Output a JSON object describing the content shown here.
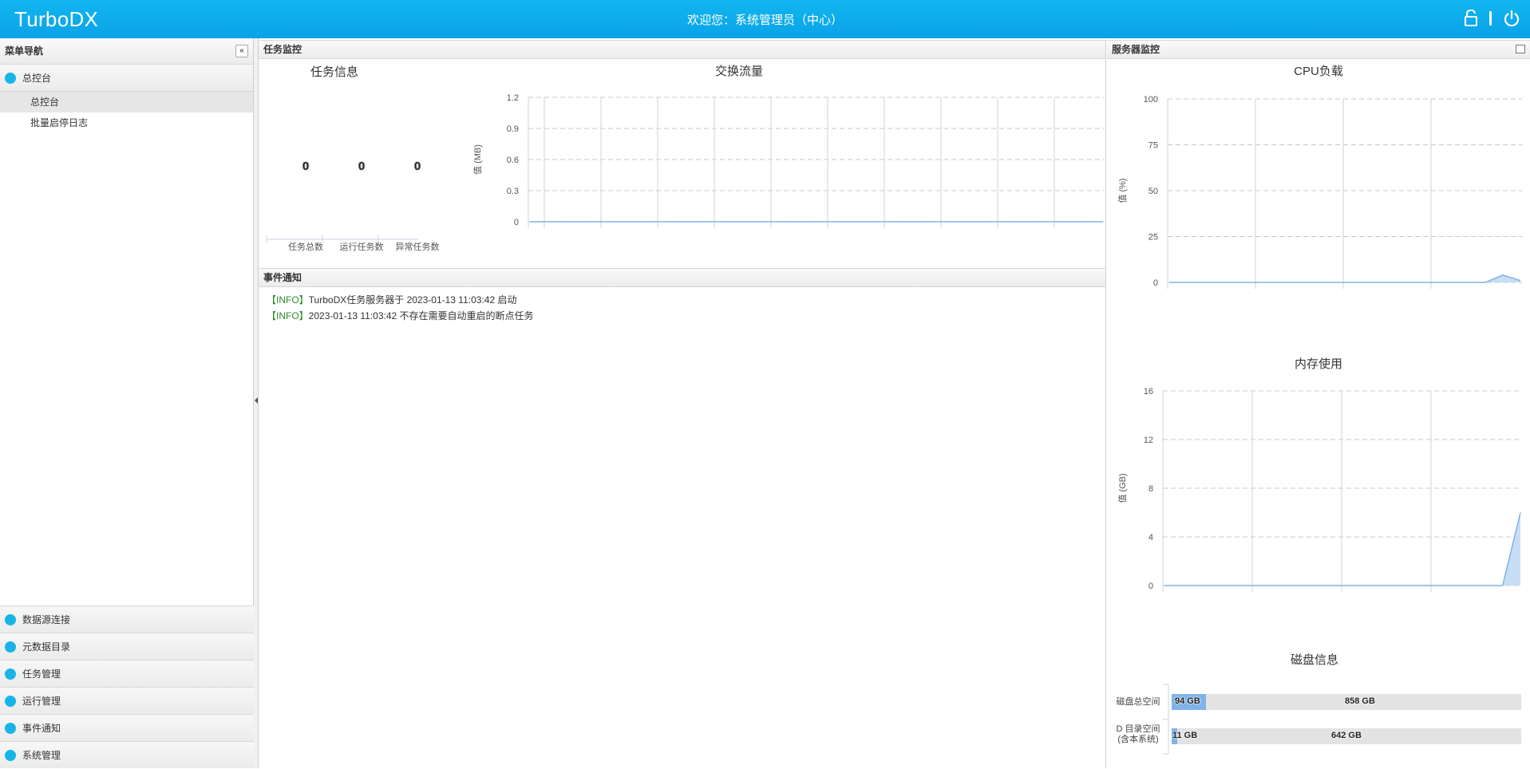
{
  "header": {
    "logo": "TurboDX",
    "welcome": "欢迎您：系统管理员（中心）"
  },
  "sidebar": {
    "title": "菜单导航",
    "group_dashboard": "总控台",
    "sub_items": [
      "总控台",
      "批量启停日志"
    ],
    "bottom_groups": [
      "数据源连接",
      "元数据目录",
      "任务管理",
      "运行管理",
      "事件通知",
      "系统管理"
    ]
  },
  "task_panel": {
    "title": "任务监控",
    "task_info": {
      "title": "任务信息",
      "stats": [
        {
          "label": "任务总数",
          "value": "0"
        },
        {
          "label": "运行任务数",
          "value": "0"
        },
        {
          "label": "异常任务数",
          "value": "0"
        }
      ]
    }
  },
  "event_panel": {
    "title": "事件通知",
    "events": [
      {
        "level": "【INFO】",
        "text": "TurboDX任务服务器于 2023-01-13 11:03:42 启动"
      },
      {
        "level": "【INFO】",
        "text": "2023-01-13 11:03:42 不存在需要自动重启的断点任务"
      }
    ]
  },
  "server_panel": {
    "title": "服务器监控",
    "disk": {
      "title": "磁盘信息",
      "rows": [
        {
          "label": [
            "磁盘总空间"
          ],
          "used": "94 GB",
          "free": "858 GB",
          "used_value": 94,
          "total_value": 952
        },
        {
          "label": [
            "D 目录空间",
            "(含本系统)"
          ],
          "used": "11 GB",
          "free": "642 GB",
          "used_value": 11,
          "total_value": 653
        }
      ]
    }
  },
  "colors": {
    "header": "#0aa3e8",
    "series": "#7fb3e8",
    "info_green": "#2e8b2e"
  },
  "chart_data": [
    {
      "type": "line",
      "title": "交换流量",
      "ylabel": "值 (MB)",
      "ylim": [
        0,
        1.2
      ],
      "yticks": [
        "1.2",
        "0.9",
        "0.6",
        "0.3",
        "0"
      ],
      "x": [
        0,
        1,
        2,
        3,
        4,
        5,
        6,
        7,
        8,
        9,
        10
      ],
      "values": [
        0,
        0,
        0,
        0,
        0,
        0,
        0,
        0,
        0,
        0,
        0
      ],
      "grid": true
    },
    {
      "type": "area",
      "title": "CPU负载",
      "ylabel": "值 (%)",
      "ylim": [
        0,
        100
      ],
      "yticks": [
        "100",
        "75",
        "50",
        "25",
        "0"
      ],
      "x": [
        0,
        1,
        2,
        3,
        4,
        5,
        6,
        7,
        8,
        9,
        10,
        11,
        12,
        13,
        14,
        15,
        16,
        17,
        18,
        19,
        20
      ],
      "values": [
        0,
        0,
        0,
        0,
        0,
        0,
        0,
        0,
        0,
        0,
        0,
        0,
        0,
        0,
        0,
        0,
        0,
        0,
        0,
        4,
        1
      ],
      "grid": true
    },
    {
      "type": "area",
      "title": "内存使用",
      "ylabel": "值 (GB)",
      "ylim": [
        0,
        16
      ],
      "yticks": [
        "16",
        "12",
        "8",
        "4",
        "0"
      ],
      "x": [
        0,
        1,
        2,
        3,
        4,
        5,
        6,
        7,
        8,
        9,
        10,
        11,
        12,
        13,
        14,
        15,
        16,
        17,
        18,
        19,
        20
      ],
      "values": [
        0,
        0,
        0,
        0,
        0,
        0,
        0,
        0,
        0,
        0,
        0,
        0,
        0,
        0,
        0,
        0,
        0,
        0,
        0,
        0,
        6
      ],
      "grid": true
    }
  ]
}
